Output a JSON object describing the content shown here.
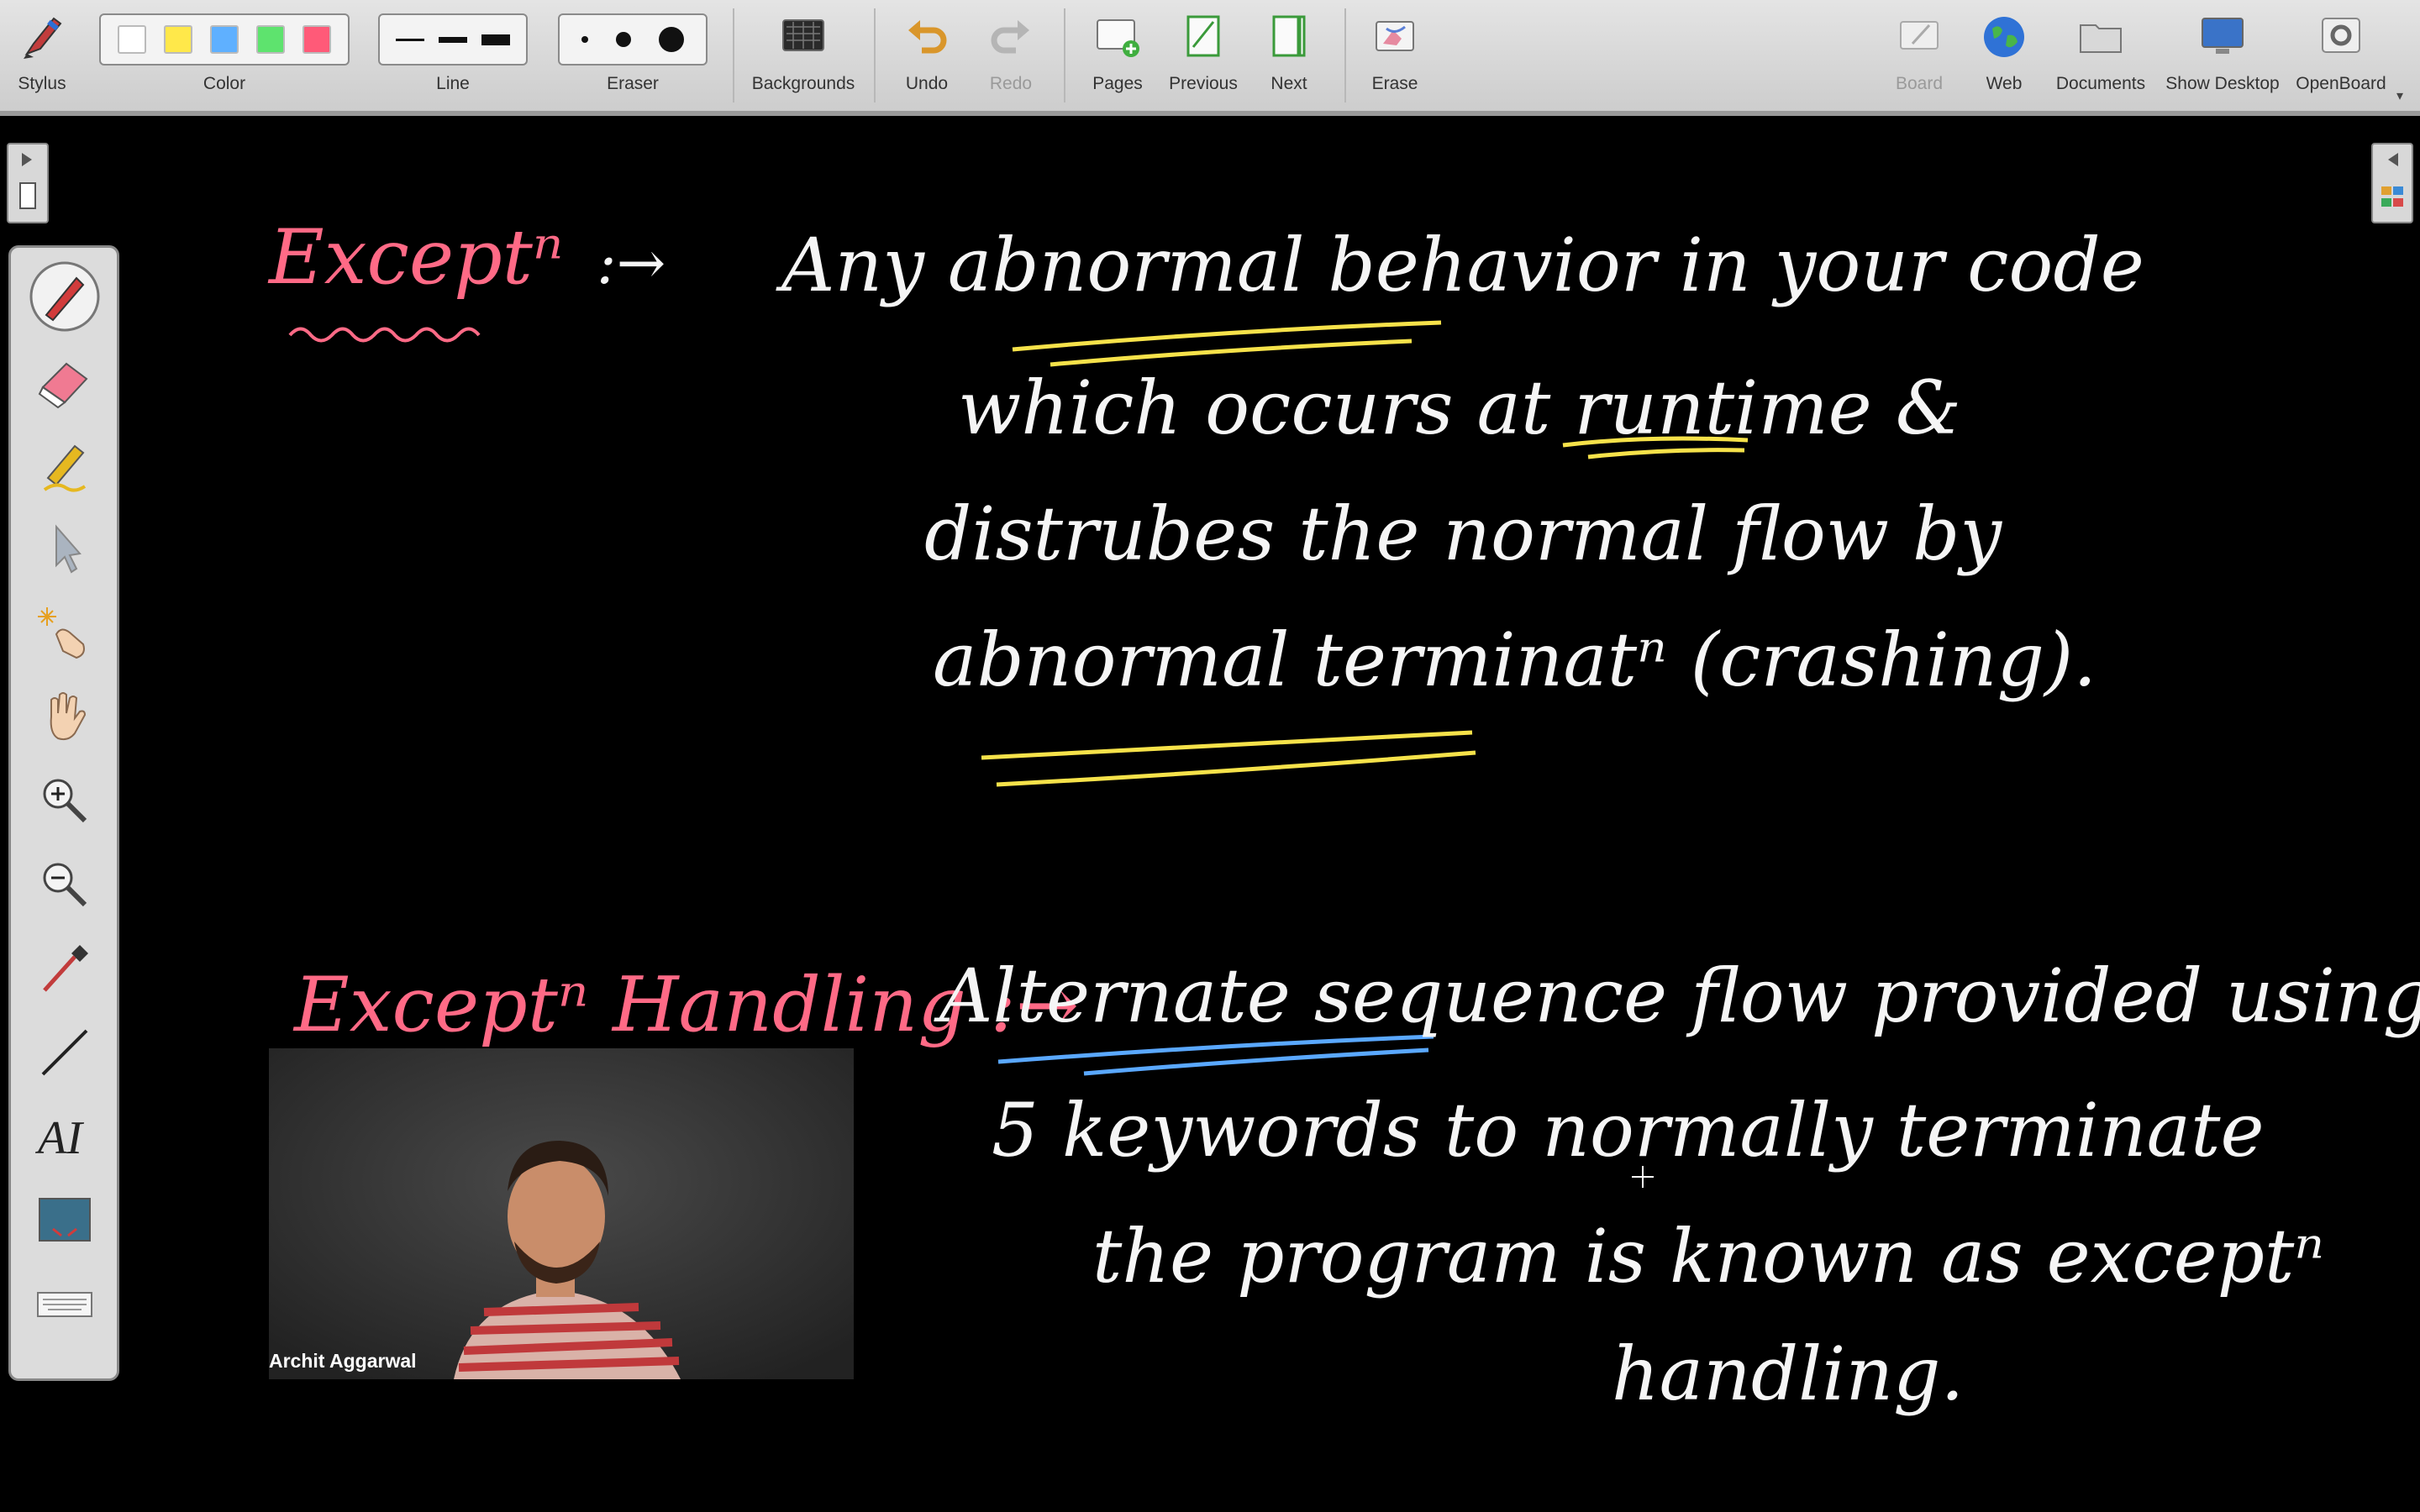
{
  "toolbar": {
    "stylus": "Stylus",
    "color": "Color",
    "line": "Line",
    "eraser": "Eraser",
    "backgrounds": "Backgrounds",
    "undo": "Undo",
    "redo": "Redo",
    "pages": "Pages",
    "previous": "Previous",
    "next": "Next",
    "erase": "Erase",
    "board": "Board",
    "web": "Web",
    "documents": "Documents",
    "show_desktop": "Show Desktop",
    "openboard": "OpenBoard"
  },
  "colors": {
    "swatches": [
      "#ffffff",
      "#ffe84a",
      "#5fb0ff",
      "#5ee36e",
      "#ff5a78"
    ],
    "ink_white": "#f5f5f5",
    "ink_pink": "#ff6a86",
    "underline_yellow": "#f6e24a",
    "underline_blue": "#5aa8ff"
  },
  "board": {
    "heading1": "Exceptⁿ",
    "arrow1": ":→",
    "def_line1": "Any abnormal behavior in your code",
    "def_line2": "which occurs at runtime &",
    "def_line3": "distrubes the normal flow by",
    "def_line4": "abnormal terminatⁿ (crashing).",
    "heading2": "Exceptⁿ Handling :→",
    "hand_line1": "Alternate sequence flow provided using",
    "hand_line2": "5 keywords to normally terminate",
    "hand_line3": "the program is known as exceptⁿ",
    "hand_line4": "handling."
  },
  "video": {
    "name": "Archit Aggarwal"
  },
  "icons": {
    "palette": [
      "pen-icon",
      "eraser-icon",
      "highlighter-icon",
      "pointer-icon",
      "laser-pointer-icon",
      "hand-icon",
      "zoom-in-icon",
      "zoom-out-icon",
      "pipette-icon",
      "line-icon",
      "text-icon",
      "capture-icon",
      "keyboard-icon"
    ]
  }
}
